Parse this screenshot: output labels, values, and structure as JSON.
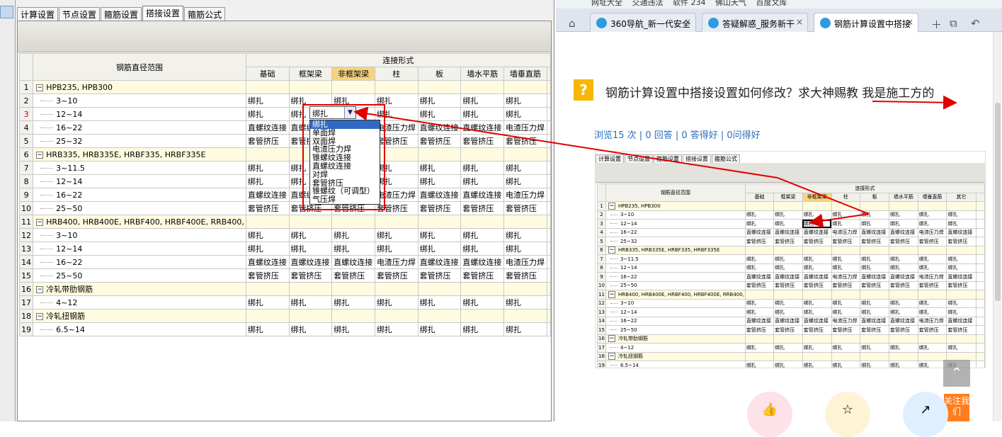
{
  "left_app": {
    "tabs": [
      "计算设置",
      "节点设置",
      "箍筋设置",
      "搭接设置",
      "箍筋公式"
    ],
    "active_tab": "搭接设置",
    "header": {
      "range_label": "钢筋直径范围",
      "group_label": "连接形式",
      "columns": [
        "基础",
        "框架梁",
        "非框架梁",
        "柱",
        "板",
        "墙水平筋",
        "墙垂直筋"
      ]
    },
    "rows": [
      {
        "n": "1",
        "label": "HPB235, HPB300",
        "group": true,
        "cells": []
      },
      {
        "n": "2",
        "label": "3~10",
        "cells": [
          "绑扎",
          "绑扎",
          "绑扎",
          "绑扎",
          "绑扎",
          "绑扎",
          "绑扎"
        ]
      },
      {
        "n": "3",
        "label": "12~14",
        "cells": [
          "绑扎",
          "绑扎",
          "绑扎",
          "绑扎",
          "绑扎",
          "绑扎",
          "绑扎"
        ]
      },
      {
        "n": "4",
        "label": "16~22",
        "cells": [
          "直螺纹连接",
          "直螺纹连接",
          "直螺纹连接",
          "电渣压力焊",
          "直螺纹连接",
          "直螺纹连接",
          "电渣压力焊"
        ]
      },
      {
        "n": "5",
        "label": "25~32",
        "cells": [
          "套管挤压",
          "套管挤压",
          "套管挤压",
          "套管挤压",
          "套管挤压",
          "套管挤压",
          "套管挤压"
        ]
      },
      {
        "n": "6",
        "label": "HRB335, HRB335E, HRBF335, HRBF335E",
        "group": true,
        "cells": []
      },
      {
        "n": "7",
        "label": "3~11.5",
        "cells": [
          "绑扎",
          "绑扎",
          "绑扎",
          "绑扎",
          "绑扎",
          "绑扎",
          "绑扎"
        ]
      },
      {
        "n": "8",
        "label": "12~14",
        "cells": [
          "绑扎",
          "绑扎",
          "绑扎",
          "绑扎",
          "绑扎",
          "绑扎",
          "绑扎"
        ]
      },
      {
        "n": "9",
        "label": "16~22",
        "cells": [
          "直螺纹连接",
          "直螺纹连接",
          "直螺纹连接",
          "电渣压力焊",
          "直螺纹连接",
          "直螺纹连接",
          "电渣压力焊"
        ]
      },
      {
        "n": "10",
        "label": "25~50",
        "cells": [
          "套管挤压",
          "套管挤压",
          "套管挤压",
          "套管挤压",
          "套管挤压",
          "套管挤压",
          "套管挤压"
        ]
      },
      {
        "n": "11",
        "label": "HRB400, HRB400E, HRBF400, HRBF400E, RRB400,",
        "group": true,
        "cells": []
      },
      {
        "n": "12",
        "label": "3~10",
        "cells": [
          "绑扎",
          "绑扎",
          "绑扎",
          "绑扎",
          "绑扎",
          "绑扎",
          "绑扎"
        ]
      },
      {
        "n": "13",
        "label": "12~14",
        "cells": [
          "绑扎",
          "绑扎",
          "绑扎",
          "绑扎",
          "绑扎",
          "绑扎",
          "绑扎"
        ]
      },
      {
        "n": "14",
        "label": "16~22",
        "cells": [
          "直螺纹连接",
          "直螺纹连接",
          "直螺纹连接",
          "电渣压力焊",
          "直螺纹连接",
          "直螺纹连接",
          "电渣压力焊"
        ]
      },
      {
        "n": "15",
        "label": "25~50",
        "cells": [
          "套管挤压",
          "套管挤压",
          "套管挤压",
          "套管挤压",
          "套管挤压",
          "套管挤压",
          "套管挤压"
        ]
      },
      {
        "n": "16",
        "label": "冷轧带肋钢筋",
        "group": true,
        "cells": []
      },
      {
        "n": "17",
        "label": "4~12",
        "cells": [
          "绑扎",
          "绑扎",
          "绑扎",
          "绑扎",
          "绑扎",
          "绑扎",
          "绑扎"
        ]
      },
      {
        "n": "18",
        "label": "冷轧扭钢筋",
        "group": true,
        "cells": []
      },
      {
        "n": "19",
        "label": "6.5~14",
        "cells": [
          "绑扎",
          "绑扎",
          "绑扎",
          "绑扎",
          "绑扎",
          "绑扎",
          "绑扎"
        ]
      }
    ],
    "combo_value": "绑扎",
    "dropdown_options": [
      "绑扎",
      "单面焊",
      "双面焊",
      "电渣压力焊",
      "锥螺纹连接",
      "直螺纹连接",
      "对焊",
      "套管挤压",
      "锥螺纹（可调型）",
      "气压焊"
    ]
  },
  "browser": {
    "bookmarks": [
      "网址大全",
      "交通违法",
      "软件 234",
      "佛山天气",
      "百度文库"
    ],
    "tabs": [
      "360导航_新一代安全",
      "答疑解惑_服务新干",
      "钢筋计算设置中搭接"
    ],
    "question_title": "钢筋计算设置中搭接设置如何修改？求大神赐教 我是施工方的",
    "stats": "浏览15 次 | 0 回答 | 0 答得好 | 0问得好",
    "shot_extra_col": "其它",
    "follow_label": "关注我们",
    "accent_color": "#2a6ebb"
  }
}
